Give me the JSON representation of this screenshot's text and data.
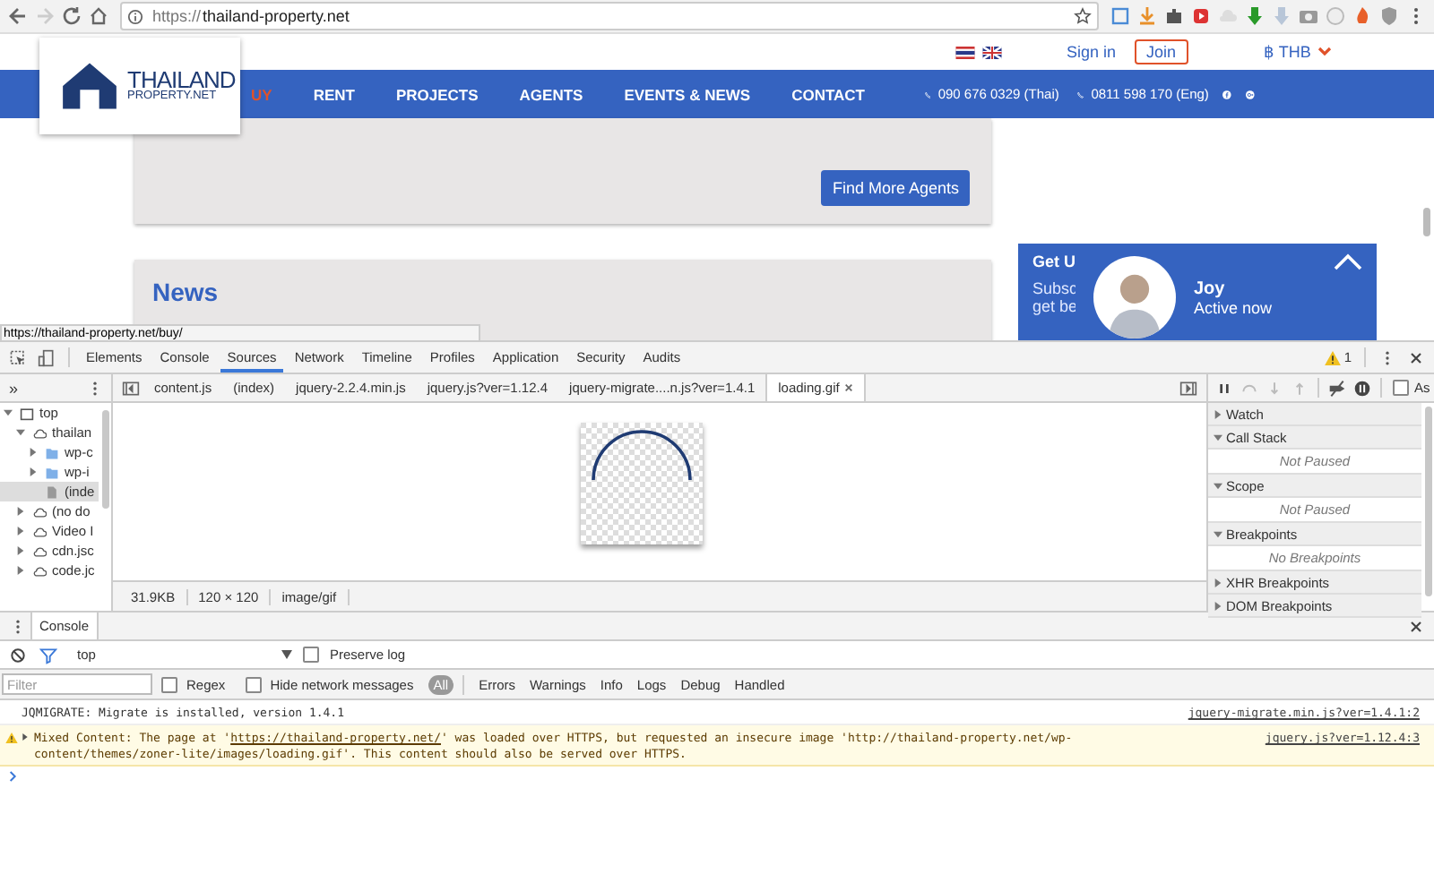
{
  "browser": {
    "url_scheme": "https://",
    "url_host": "thailand-property.net",
    "back_disabled": false,
    "forward_disabled": true
  },
  "site": {
    "logo": {
      "title": "THAILAND",
      "subtitle": "PROPERTY.NET"
    },
    "top_links": {
      "sign_in": "Sign in",
      "join": "Join",
      "currency": "฿ THB"
    },
    "nav": [
      {
        "label": "UY",
        "selected": true
      },
      {
        "label": "RENT",
        "selected": false
      },
      {
        "label": "PROJECTS",
        "selected": false
      },
      {
        "label": "AGENTS",
        "selected": false
      },
      {
        "label": "EVENTS & NEWS",
        "selected": false
      },
      {
        "label": "CONTACT",
        "selected": false
      }
    ],
    "phones": [
      "090 676 0329 (Thai)",
      "0811 598 170 (Eng)"
    ],
    "find_button": "Find More Agents",
    "news_title": "News",
    "subscribe": {
      "title": "Get U",
      "line_1": "Subsc",
      "line_2": "get be"
    },
    "chat": {
      "name": "Joy",
      "status": "Active now"
    },
    "status_url": "https://thailand-property.net/buy/"
  },
  "devtools": {
    "tabs": [
      {
        "label": "Elements",
        "selected": false
      },
      {
        "label": "Console",
        "selected": false
      },
      {
        "label": "Sources",
        "selected": true
      },
      {
        "label": "Network",
        "selected": false
      },
      {
        "label": "Timeline",
        "selected": false
      },
      {
        "label": "Profiles",
        "selected": false
      },
      {
        "label": "Application",
        "selected": false
      },
      {
        "label": "Security",
        "selected": false
      },
      {
        "label": "Audits",
        "selected": false
      }
    ],
    "warning_count": "1",
    "navigator_more": "»",
    "tree": [
      {
        "label": "top",
        "kind": "frame",
        "expanded": true,
        "selected": false,
        "children": [
          {
            "label": "thailan",
            "kind": "domain",
            "expanded": true,
            "selected": false,
            "children": [
              {
                "label": "wp-c",
                "kind": "folder",
                "expanded": false,
                "selected": false
              },
              {
                "label": "wp-i",
                "kind": "folder",
                "expanded": false,
                "selected": false
              },
              {
                "label": "(inde",
                "kind": "file",
                "selected": true
              }
            ]
          },
          {
            "label": "(no do",
            "kind": "domain",
            "expanded": false,
            "selected": false
          },
          {
            "label": "Video I",
            "kind": "domain",
            "expanded": false,
            "selected": false
          },
          {
            "label": "cdn.jsc",
            "kind": "domain",
            "expanded": false,
            "selected": false
          },
          {
            "label": "code.jc",
            "kind": "domain",
            "expanded": false,
            "selected": false
          }
        ]
      }
    ],
    "files": [
      {
        "label": "content.js",
        "selected": false
      },
      {
        "label": "(index)",
        "selected": false
      },
      {
        "label": "jquery-2.2.4.min.js",
        "selected": false
      },
      {
        "label": "jquery.js?ver=1.12.4",
        "selected": false
      },
      {
        "label": "jquery-migrate....n.js?ver=1.4.1",
        "selected": false
      },
      {
        "label": "loading.gif",
        "selected": true
      }
    ],
    "image_info": [
      "31.9KB",
      "120 × 120",
      "image/gif"
    ],
    "async_label": "As",
    "async_checked": false,
    "sections": [
      {
        "label": "Watch",
        "expanded": false
      },
      {
        "label": "Call Stack",
        "expanded": true,
        "note": "Not Paused"
      },
      {
        "label": "Scope",
        "expanded": true,
        "note": "Not Paused"
      },
      {
        "label": "Breakpoints",
        "expanded": true,
        "note": "No Breakpoints"
      },
      {
        "label": "XHR Breakpoints",
        "expanded": false
      },
      {
        "label": "DOM Breakpoints",
        "expanded": false
      }
    ]
  },
  "console": {
    "tab": "Console",
    "context": "top",
    "preserve_log": {
      "label": "Preserve log",
      "checked": false
    },
    "filter_placeholder": "Filter",
    "regex": {
      "label": "Regex",
      "checked": false
    },
    "hide_network": {
      "label": "Hide network messages",
      "checked": false
    },
    "levels": [
      {
        "label": "All",
        "selected": true
      },
      {
        "label": "Errors",
        "selected": false
      },
      {
        "label": "Warnings",
        "selected": false
      },
      {
        "label": "Info",
        "selected": false
      },
      {
        "label": "Logs",
        "selected": false
      },
      {
        "label": "Debug",
        "selected": false
      },
      {
        "label": "Handled",
        "selected": false
      }
    ],
    "messages": [
      {
        "kind": "log",
        "text": "JQMIGRATE: Migrate is installed, version 1.4.1",
        "source": "jquery-migrate.min.js?ver=1.4.1:2"
      },
      {
        "kind": "warning",
        "text": "Mixed Content: The page at '",
        "link": "https://thailand-property.net/",
        "text_after": "' was loaded over HTTPS, but requested an insecure image 'http://thailand-property.net/wp-content/themes/zoner-lite/images/loading.gif'. This content should also be served over HTTPS.",
        "source": "jquery.js?ver=1.12.4:3"
      }
    ]
  }
}
